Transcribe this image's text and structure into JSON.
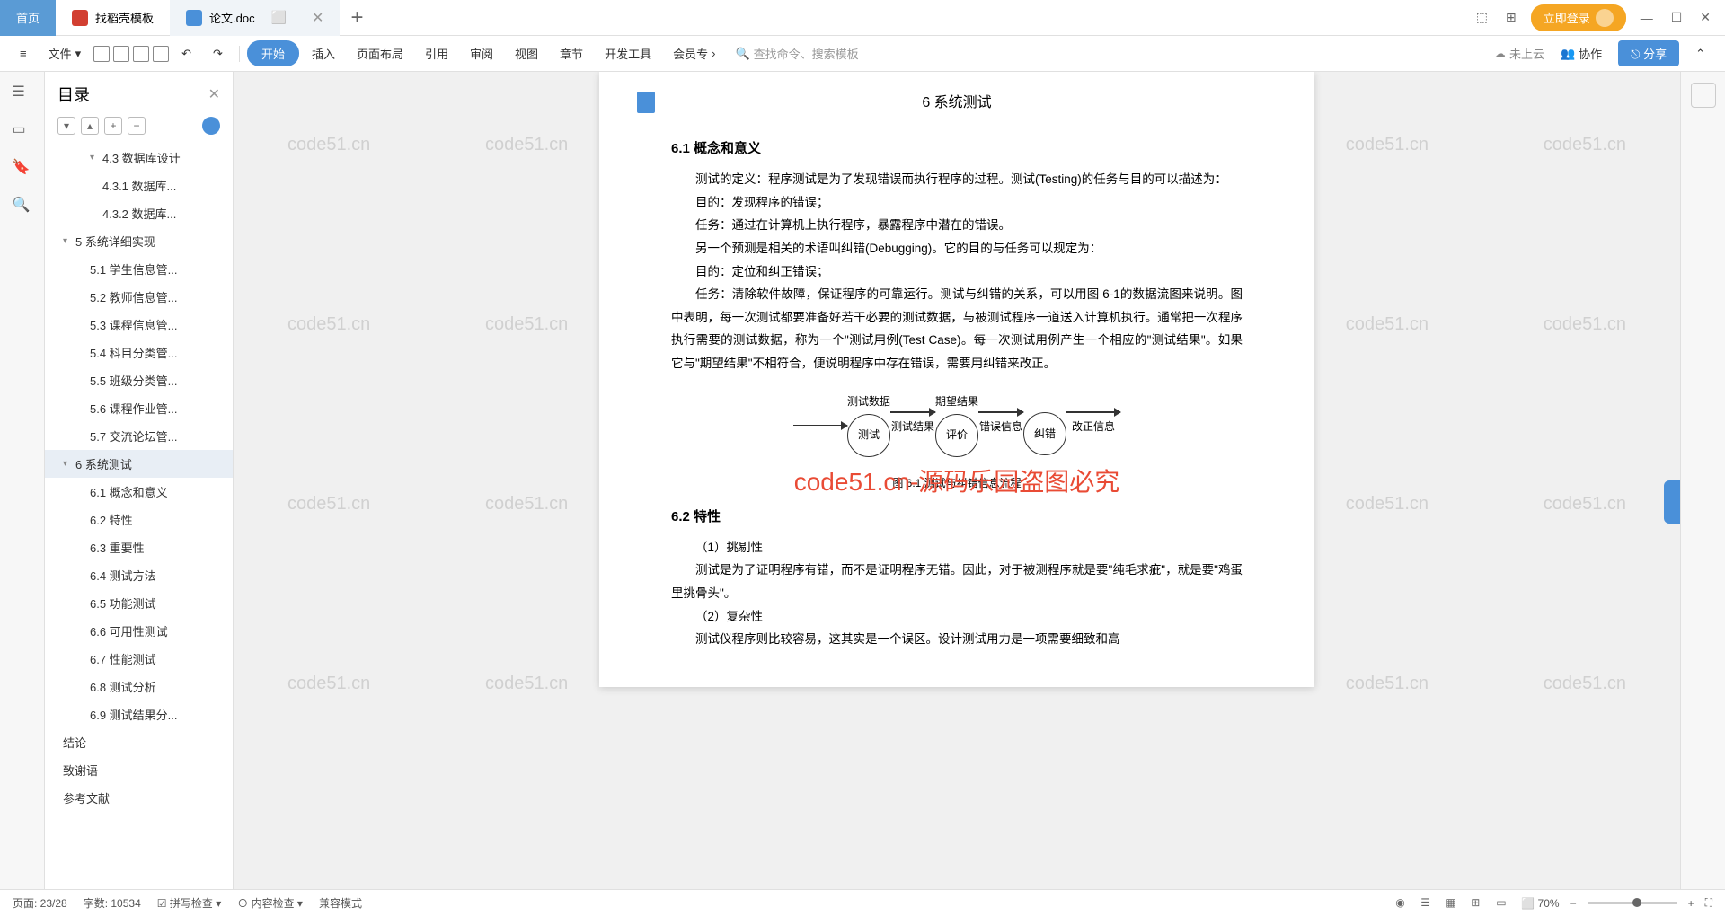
{
  "tabs": {
    "home": "首页",
    "template": "找稻壳模板",
    "doc": "论文.doc"
  },
  "login_btn": "立即登录",
  "menu": {
    "file": "文件",
    "start": "开始",
    "insert": "插入",
    "layout": "页面布局",
    "ref": "引用",
    "review": "审阅",
    "view": "视图",
    "chapter": "章节",
    "dev": "开发工具",
    "member": "会员专"
  },
  "search_placeholder": "查找命令、搜索模板",
  "cloud": "未上云",
  "collab": "协作",
  "share": "分享",
  "sidebar": {
    "title": "目录",
    "items": [
      {
        "l": "l2",
        "t": "4.3 数据库设计",
        "chev": "▾"
      },
      {
        "l": "l3",
        "t": "4.3.1 数据库..."
      },
      {
        "l": "l3",
        "t": "4.3.2 数据库..."
      },
      {
        "l": "l1",
        "t": "5 系统详细实现",
        "chev": "▾"
      },
      {
        "l": "l2",
        "t": "5.1 学生信息管..."
      },
      {
        "l": "l2",
        "t": "5.2 教师信息管..."
      },
      {
        "l": "l2",
        "t": "5.3 课程信息管..."
      },
      {
        "l": "l2",
        "t": "5.4 科目分类管..."
      },
      {
        "l": "l2",
        "t": "5.5 班级分类管..."
      },
      {
        "l": "l2",
        "t": "5.6 课程作业管..."
      },
      {
        "l": "l2",
        "t": "5.7 交流论坛管..."
      },
      {
        "l": "l1",
        "t": "6 系统测试",
        "chev": "▾",
        "active": true
      },
      {
        "l": "l2",
        "t": "6.1 概念和意义"
      },
      {
        "l": "l2",
        "t": "6.2 特性"
      },
      {
        "l": "l2",
        "t": "6.3 重要性"
      },
      {
        "l": "l2",
        "t": "6.4 测试方法"
      },
      {
        "l": "l2",
        "t": "6.5 功能测试"
      },
      {
        "l": "l2",
        "t": "6.6 可用性测试"
      },
      {
        "l": "l2",
        "t": "6.7 性能测试"
      },
      {
        "l": "l2",
        "t": "6.8 测试分析"
      },
      {
        "l": "l2",
        "t": "6.9 测试结果分..."
      },
      {
        "l": "l1",
        "t": "结论"
      },
      {
        "l": "l1",
        "t": "致谢语"
      },
      {
        "l": "l1",
        "t": "参考文献"
      }
    ]
  },
  "doc": {
    "h1": "6 系统测试",
    "h2a": "6.1 概念和意义",
    "p1": "测试的定义：程序测试是为了发现错误而执行程序的过程。测试(Testing)的任务与目的可以描述为：",
    "p2": "目的：发现程序的错误；",
    "p3": "任务：通过在计算机上执行程序，暴露程序中潜在的错误。",
    "p4": "另一个预测是相关的术语叫纠错(Debugging)。它的目的与任务可以规定为：",
    "p5": "目的：定位和纠正错误；",
    "p6": "任务：清除软件故障，保证程序的可靠运行。测试与纠错的关系，可以用图 6-1的数据流图来说明。图中表明，每一次测试都要准备好若干必要的测试数据，与被测试程序一道送入计算机执行。通常把一次程序执行需要的测试数据，称为一个\"测试用例(Test Case)。每一次测试用例产生一个相应的\"测试结果\"。如果它与\"期望结果\"不相符合，便说明程序中存在错误，需要用纠错来改正。",
    "diagram": {
      "l1": "测试数据",
      "l2": "期望结果",
      "c1": "测试",
      "c2": "评价",
      "c3": "纠错",
      "a1": "测试结果",
      "a2": "错误信息",
      "a3": "改正信息"
    },
    "caption": "图 6.1 测试与纠错信息流程",
    "h2b": "6.2 特性",
    "p7": "（1）挑剔性",
    "p8": "测试是为了证明程序有错，而不是证明程序无错。因此，对于被测程序就是要\"纯毛求疵\"，就是要\"鸡蛋里挑骨头\"。",
    "p9": "（2）复杂性",
    "p10": "测试仪程序则比较容易，这其实是一个误区。设计测试用力是一项需要细致和高"
  },
  "status": {
    "page": "页面: 23/28",
    "words": "字数: 10534",
    "spell": "拼写检查",
    "content": "内容检查",
    "compat": "兼容模式",
    "zoom": "70%"
  },
  "watermark": "code51.cn",
  "wm_red": "code51.cn-源码乐园盗图必究"
}
